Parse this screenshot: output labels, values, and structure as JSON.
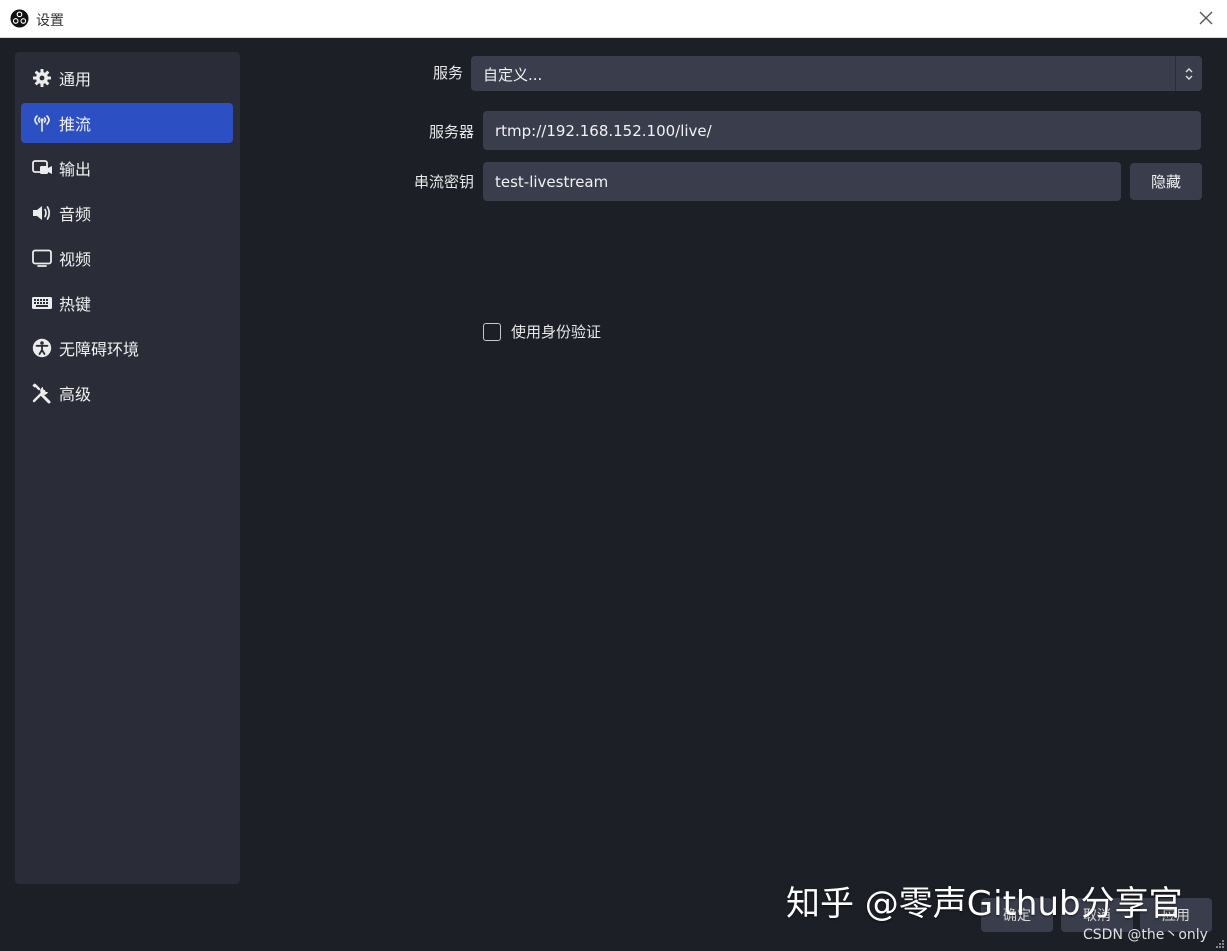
{
  "window": {
    "title": "设置",
    "close_icon": "close-icon",
    "logo_icon": "obs-logo-icon"
  },
  "sidebar": {
    "items": [
      {
        "label": "通用",
        "icon": "gear-icon"
      },
      {
        "label": "推流",
        "icon": "antenna-icon",
        "active": true
      },
      {
        "label": "输出",
        "icon": "output-icon"
      },
      {
        "label": "音频",
        "icon": "speaker-icon"
      },
      {
        "label": "视频",
        "icon": "monitor-icon"
      },
      {
        "label": "热键",
        "icon": "keyboard-icon"
      },
      {
        "label": "无障碍环境",
        "icon": "accessibility-icon"
      },
      {
        "label": "高级",
        "icon": "tools-icon"
      }
    ]
  },
  "stream": {
    "service_label": "服务",
    "service_value": "自定义...",
    "server_label": "服务器",
    "server_value": "rtmp://192.168.152.100/live/",
    "key_label": "串流密钥",
    "key_value": "test-livestream",
    "hide_button": "隐藏",
    "auth_checkbox_label": "使用身份验证",
    "auth_checked": false
  },
  "footer": {
    "ok": "确定",
    "cancel": "取消",
    "apply": "应用"
  },
  "watermark": {
    "main": "知乎 @零声Github分享官",
    "sub": "CSDN @the丶only"
  },
  "colors": {
    "background": "#1d1f27",
    "sidebar": "#2a2c37",
    "active": "#2c4fc4",
    "field": "#3a3d4c"
  }
}
